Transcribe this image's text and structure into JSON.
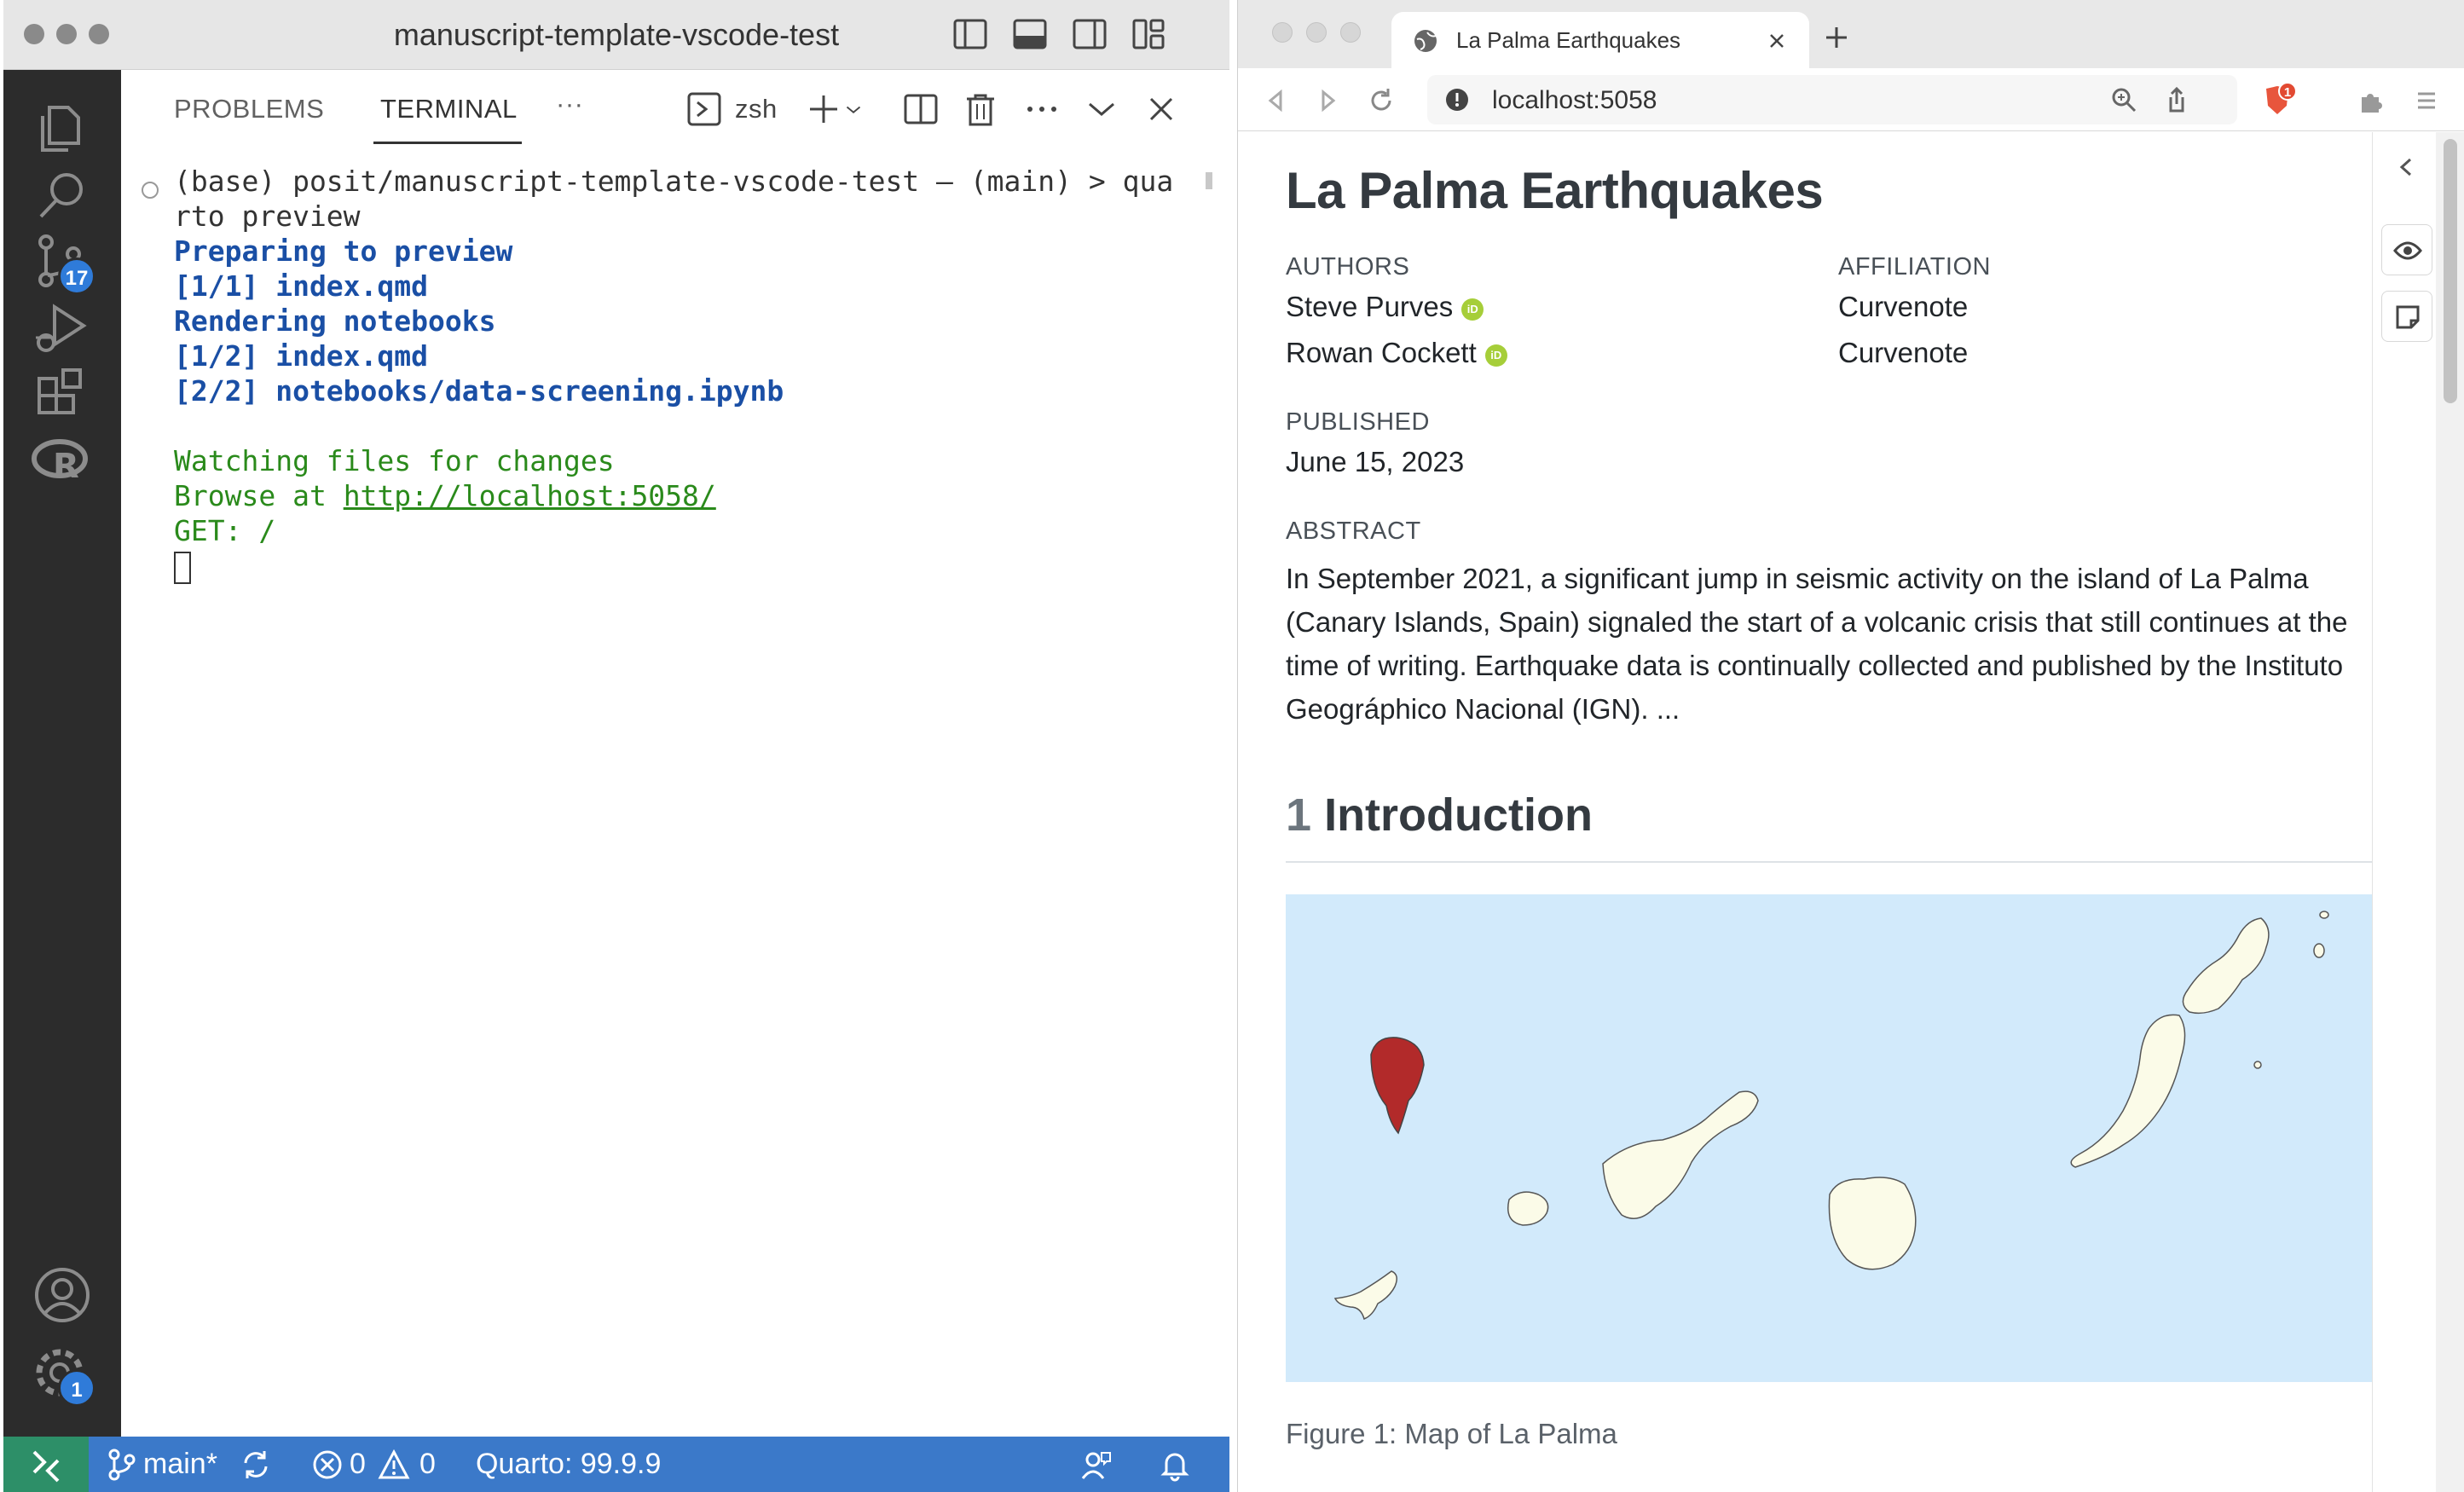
{
  "vscode": {
    "window_title": "manuscript-template-vscode-test",
    "activity_badges": {
      "source_control": "17",
      "settings": "1"
    },
    "panel": {
      "tabs": [
        "PROBLEMS",
        "TERMINAL"
      ],
      "more": "···",
      "shell_name": "zsh"
    },
    "terminal": {
      "line1": "(base) posit/manuscript-template-vscode-test – (main) > qua",
      "line2": "rto preview",
      "line3": "Preparing to preview",
      "line4": "[1/1] index.qmd",
      "line5": "Rendering notebooks",
      "line6": "[1/2] index.qmd",
      "line7": "[2/2] notebooks/data-screening.ipynb",
      "line8": "Watching files for changes",
      "line9_prefix": "Browse at ",
      "line9_link": "http://localhost:5058/",
      "line10": "GET: /"
    },
    "statusbar": {
      "branch": "main*",
      "errors": "0",
      "warnings": "0",
      "quarto": "Quarto: 99.9.9"
    }
  },
  "browser": {
    "tab_title": "La Palma Earthquakes",
    "url": "localhost:5058",
    "extension_badge": "1"
  },
  "article": {
    "title": "La Palma Earthquakes",
    "authors_label": "AUTHORS",
    "affiliation_label": "AFFILIATION",
    "authors": [
      {
        "name": "Steve Purves",
        "affiliation": "Curvenote"
      },
      {
        "name": "Rowan Cockett",
        "affiliation": "Curvenote"
      }
    ],
    "orcid_label": "iD",
    "published_label": "PUBLISHED",
    "published_date": "June 15, 2023",
    "abstract_label": "ABSTRACT",
    "abstract_text": "In September 2021, a significant jump in seismic activity on the island of La Palma (Canary Islands, Spain) signaled the start of a volcanic crisis that still continues at the time of writing. Earthquake data is continually collected and published by the Instituto Geográphico Nacional (IGN). ...",
    "section_number": "1",
    "section_title": "Introduction",
    "figure_caption": "Figure 1: Map of La Palma"
  },
  "colors": {
    "statusbar": "#3b79c9",
    "remote": "#2d8f68",
    "terminal_blue": "#1a4fa5",
    "terminal_green": "#2a8a1b",
    "map_sea": "#d2eafb",
    "map_land": "#fbfbe8",
    "map_highlight": "#b22a2a"
  }
}
